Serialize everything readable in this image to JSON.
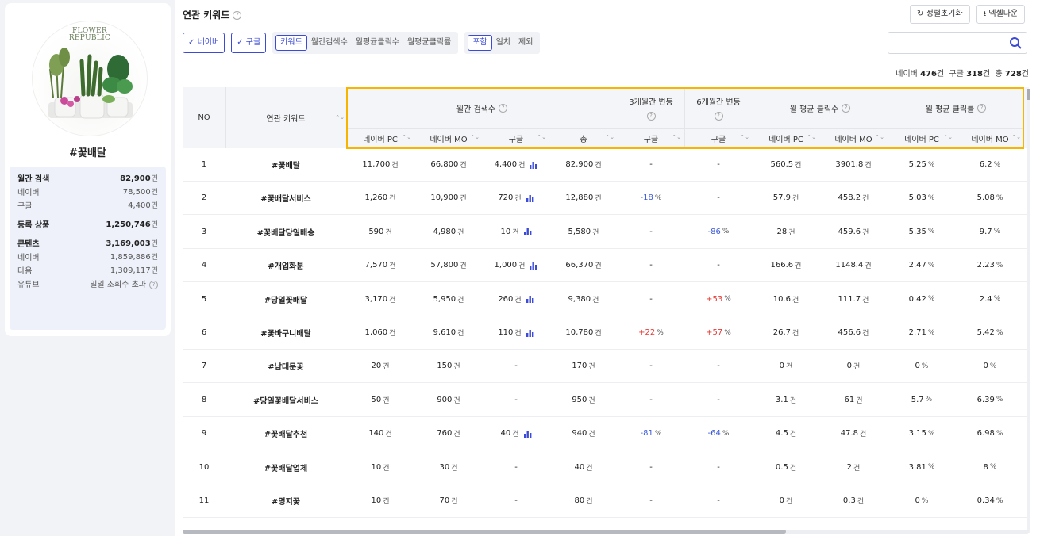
{
  "sidebar": {
    "logo_line1": "FLOWER",
    "logo_line2": "REPUBLIC",
    "product": "#꽃배달",
    "stats": [
      {
        "label": "월간 검색",
        "value": "82,900",
        "unit": "건",
        "main": true
      },
      {
        "label": "네이버",
        "value": "78,500",
        "unit": "건"
      },
      {
        "label": "구글",
        "value": "4,400",
        "unit": "건"
      },
      {
        "label": "등록 상품",
        "value": "1,250,746",
        "unit": "건",
        "main": true
      },
      {
        "label": "콘텐츠",
        "value": "3,169,003",
        "unit": "건",
        "main": true
      },
      {
        "label": "네이버",
        "value": "1,859,886",
        "unit": "건"
      },
      {
        "label": "다음",
        "value": "1,309,117",
        "unit": "건"
      },
      {
        "label": "유튜브",
        "value": "일일 조회수 초과",
        "unit": ""
      }
    ]
  },
  "header": {
    "title": "연관 키워드",
    "reset_label": "정렬초기화",
    "excel_label": "엑셀다운"
  },
  "filters": {
    "naver": "네이버",
    "google": "구글",
    "sort_items": [
      "키워드",
      "월간검색수",
      "월평균클릭수",
      "월평균클릭률"
    ],
    "match_items": [
      "포함",
      "일치",
      "제외"
    ],
    "search_placeholder": ""
  },
  "counts": {
    "naver_label": "네이버",
    "naver": "476",
    "google_label": "구글",
    "google": "318",
    "total_label": "총",
    "total": "728",
    "unit": "건"
  },
  "table": {
    "headers": {
      "no": "NO",
      "keyword": "연관 키워드",
      "monthly": "월간 검색수",
      "change3": "3개월간 변동",
      "change6": "6개월간 변동",
      "clicks": "월 평균 클릭수",
      "ctr": "월 평균 클릭률",
      "naver_pc": "네이버 PC",
      "naver_mo": "네이버 MO",
      "google": "구글",
      "total": "총"
    },
    "rows": [
      {
        "no": "1",
        "kw": "#꽃배달",
        "pc": "11,700",
        "mo": "66,800",
        "g": "4,400",
        "bar": true,
        "t": "82,900",
        "c3": "-",
        "c6": "-",
        "cpc": "560.5",
        "cmo": "3901.8",
        "rpc": "5.25",
        "rmo": "6.2"
      },
      {
        "no": "2",
        "kw": "#꽃배달서비스",
        "pc": "1,260",
        "mo": "10,900",
        "g": "720",
        "bar": true,
        "t": "12,880",
        "c3": "-18",
        "c6": "-",
        "cpc": "57.9",
        "cmo": "458.2",
        "rpc": "5.03",
        "rmo": "5.08"
      },
      {
        "no": "3",
        "kw": "#꽃배달당일배송",
        "pc": "590",
        "mo": "4,980",
        "g": "10",
        "bar": true,
        "t": "5,580",
        "c3": "-",
        "c6": "-86",
        "cpc": "28",
        "cmo": "459.6",
        "rpc": "5.35",
        "rmo": "9.7"
      },
      {
        "no": "4",
        "kw": "#개업화분",
        "pc": "7,570",
        "mo": "57,800",
        "g": "1,000",
        "bar": true,
        "t": "66,370",
        "c3": "-",
        "c6": "-",
        "cpc": "166.6",
        "cmo": "1148.4",
        "rpc": "2.47",
        "rmo": "2.23"
      },
      {
        "no": "5",
        "kw": "#당일꽃배달",
        "pc": "3,170",
        "mo": "5,950",
        "g": "260",
        "bar": true,
        "t": "9,380",
        "c3": "-",
        "c6": "+53",
        "cpc": "10.6",
        "cmo": "111.7",
        "rpc": "0.42",
        "rmo": "2.4"
      },
      {
        "no": "6",
        "kw": "#꽃바구니배달",
        "pc": "1,060",
        "mo": "9,610",
        "g": "110",
        "bar": true,
        "t": "10,780",
        "c3": "+22",
        "c6": "+57",
        "cpc": "26.7",
        "cmo": "456.6",
        "rpc": "2.71",
        "rmo": "5.42"
      },
      {
        "no": "7",
        "kw": "#남대문꽃",
        "pc": "20",
        "mo": "150",
        "g": "-",
        "bar": false,
        "t": "170",
        "c3": "-",
        "c6": "-",
        "cpc": "0",
        "cmo": "0",
        "rpc": "0",
        "rmo": "0"
      },
      {
        "no": "8",
        "kw": "#당일꽃배달서비스",
        "pc": "50",
        "mo": "900",
        "g": "-",
        "bar": false,
        "t": "950",
        "c3": "-",
        "c6": "-",
        "cpc": "3.1",
        "cmo": "61",
        "rpc": "5.7",
        "rmo": "6.39"
      },
      {
        "no": "9",
        "kw": "#꽃배달추천",
        "pc": "140",
        "mo": "760",
        "g": "40",
        "bar": true,
        "t": "940",
        "c3": "-81",
        "c6": "-64",
        "cpc": "4.5",
        "cmo": "47.8",
        "rpc": "3.15",
        "rmo": "6.98"
      },
      {
        "no": "10",
        "kw": "#꽃배달업체",
        "pc": "10",
        "mo": "30",
        "g": "-",
        "bar": false,
        "t": "40",
        "c3": "-",
        "c6": "-",
        "cpc": "0.5",
        "cmo": "2",
        "rpc": "3.81",
        "rmo": "8"
      },
      {
        "no": "11",
        "kw": "#명지꽃",
        "pc": "10",
        "mo": "70",
        "g": "-",
        "bar": false,
        "t": "80",
        "c3": "-",
        "c6": "-",
        "cpc": "0",
        "cmo": "0.3",
        "rpc": "0",
        "rmo": "0.34"
      }
    ],
    "unit_count": "건",
    "unit_pct": "%"
  },
  "colors": {
    "accent": "#3b4bd8",
    "highlight": "#f7b500",
    "negative": "#3d5bd9",
    "positive": "#e53935"
  }
}
